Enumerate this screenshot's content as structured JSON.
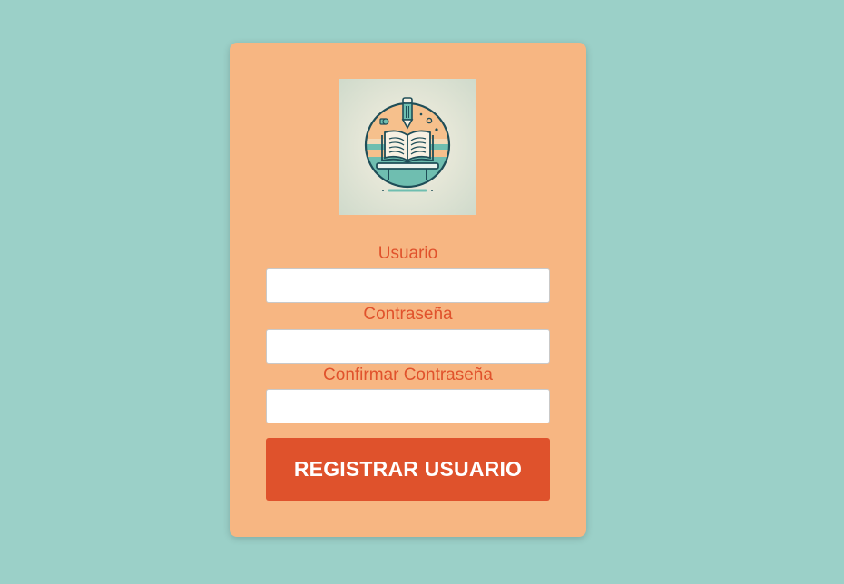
{
  "background_color": "#9bd0c8",
  "card_color": "#f7b682",
  "accent_color": "#df522c",
  "logo": {
    "icon": "open-book-pencil-logo"
  },
  "form": {
    "username_label": "Usuario",
    "username_value": "",
    "password_label": "Contraseña",
    "password_value": "",
    "confirm_label": "Confirmar Contraseña",
    "confirm_value": "",
    "submit_label": "REGISTRAR USUARIO"
  }
}
